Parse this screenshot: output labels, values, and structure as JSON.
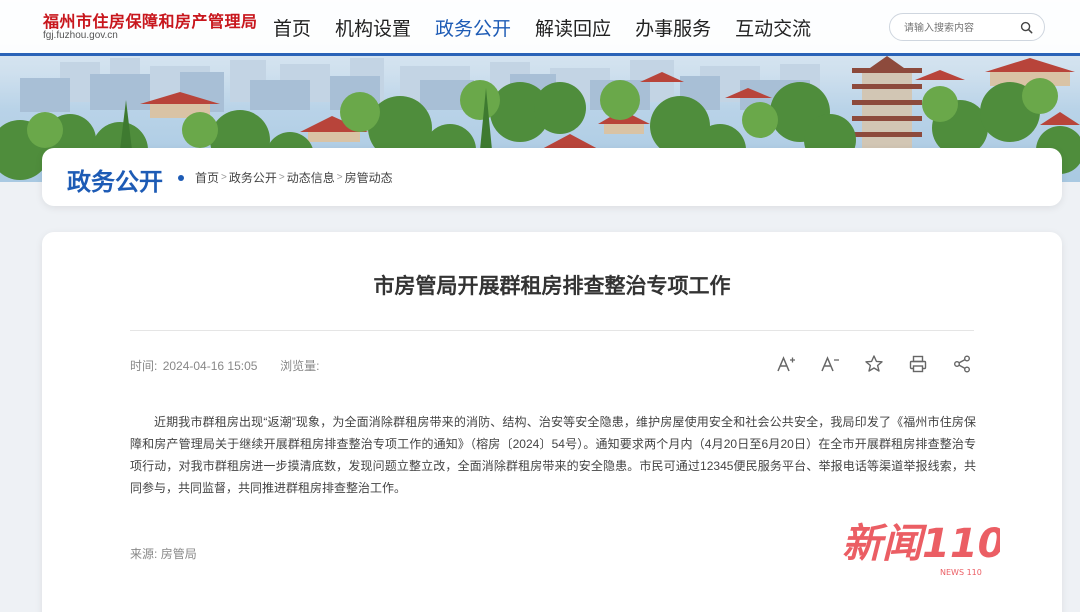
{
  "header": {
    "site_name": "福州市住房保障和房产管理局",
    "site_url": "fgj.fuzhou.gov.cn",
    "nav": [
      {
        "label": "首页",
        "active": false
      },
      {
        "label": "机构设置",
        "active": false
      },
      {
        "label": "政务公开",
        "active": true
      },
      {
        "label": "解读回应",
        "active": false
      },
      {
        "label": "办事服务",
        "active": false
      },
      {
        "label": "互动交流",
        "active": false
      }
    ],
    "search": {
      "placeholder": "请输入搜索内容",
      "value": ""
    }
  },
  "breadcrumb": {
    "section_title": "政务公开",
    "items": [
      "首页",
      "政务公开",
      "动态信息",
      "房管动态"
    ],
    "separator": ">"
  },
  "article": {
    "title": "市房管局开展群租房排查整治专项工作",
    "time_label": "时间:",
    "time_value": "2024-04-16 15:05",
    "views_label": "浏览量:",
    "views_value": "",
    "tools": [
      {
        "name": "font-increase-icon",
        "glyph": "A⁺"
      },
      {
        "name": "font-decrease-icon",
        "glyph": "A⁻"
      },
      {
        "name": "favorite-star-icon",
        "glyph": "☆"
      },
      {
        "name": "print-icon",
        "glyph": ""
      },
      {
        "name": "share-icon",
        "glyph": ""
      }
    ],
    "body": "近期我市群租房出现“返潮”现象，为全面消除群租房带来的消防、结构、治安等安全隐患，维护房屋使用安全和社会公共安全，我局印发了《福州市住房保障和房产管理局关于继续开展群租房排查整治专项工作的通知》（榕房〔2024〕54号）。通知要求两个月内（4月20日至6月20日）在全市开展群租房排查整治专项行动，对我市群租房进一步摸清底数，发现问题立整立改，全面消除群租房带来的安全隐患。市民可通过12345便民服务平台、举报电话等渠道举报线索，共同参与，共同监督，共同推进群租房排查整治工作。",
    "source_label": "来源:",
    "source_value": "房管局"
  },
  "watermark": {
    "text": "新闻110",
    "sub": "NEWS 110"
  },
  "colors": {
    "accent": "#1d5bb5",
    "logo_red": "#c8161d",
    "watermark_red": "#e8424a"
  }
}
